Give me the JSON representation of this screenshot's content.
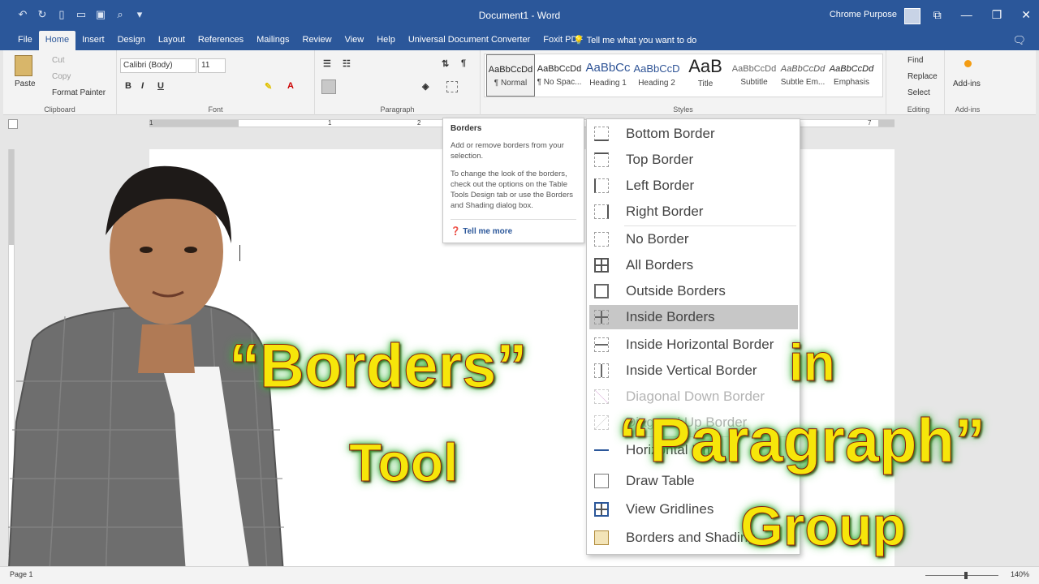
{
  "titlebar": {
    "doc_title": "Document1 - Word",
    "user": "Chrome Purpose"
  },
  "tabs": [
    "File",
    "Home",
    "Insert",
    "Design",
    "Layout",
    "References",
    "Mailings",
    "Review",
    "View",
    "Help",
    "Universal Document Converter",
    "Foxit PDF"
  ],
  "tell_me": "Tell me what you want to do",
  "clipboard": {
    "paste": "Paste",
    "cut": "Cut",
    "copy": "Copy",
    "format_painter": "Format Painter",
    "label": "Clipboard"
  },
  "font": {
    "name": "Calibri (Body)",
    "size": "11",
    "label": "Font"
  },
  "paragraph": {
    "label": "Paragraph"
  },
  "styles": {
    "label": "Styles",
    "items": [
      {
        "preview": "AaBbCcDd",
        "name": "¶ Normal"
      },
      {
        "preview": "AaBbCcDd",
        "name": "¶ No Spac..."
      },
      {
        "preview": "AaBbCc",
        "name": "Heading 1"
      },
      {
        "preview": "AaBbCcD",
        "name": "Heading 2"
      },
      {
        "preview": "AaB",
        "name": "Title"
      },
      {
        "preview": "AaBbCcDd",
        "name": "Subtitle"
      },
      {
        "preview": "AaBbCcDd",
        "name": "Subtle Em..."
      },
      {
        "preview": "AaBbCcDd",
        "name": "Emphasis"
      }
    ]
  },
  "editing": {
    "find": "Find",
    "replace": "Replace",
    "select": "Select",
    "label": "Editing"
  },
  "addins": {
    "button": "Add-ins",
    "label": "Add-ins"
  },
  "ruler_numbers": [
    "1",
    "1",
    "2",
    "7"
  ],
  "tooltip": {
    "title": "Borders",
    "p1": "Add or remove borders from your selection.",
    "p2": "To change the look of the borders, check out the options on the Table Tools Design tab or use the Borders and Shading dialog box.",
    "more": "Tell me more"
  },
  "border_menu": [
    {
      "label": "Bottom Border"
    },
    {
      "label": "Top Border"
    },
    {
      "label": "Left Border"
    },
    {
      "label": "Right Border"
    },
    {
      "label": "No Border"
    },
    {
      "label": "All Borders"
    },
    {
      "label": "Outside Borders"
    },
    {
      "label": "Inside Borders"
    },
    {
      "label": "Inside Horizontal Border"
    },
    {
      "label": "Inside Vertical Border"
    },
    {
      "label": "Diagonal Down Border"
    },
    {
      "label": "Diagonal Up Border"
    },
    {
      "label": "Horizontal Line"
    },
    {
      "label": "Draw Table"
    },
    {
      "label": "View Gridlines"
    },
    {
      "label": "Borders and Shading..."
    }
  ],
  "status": {
    "page": "Page 1",
    "zoom": "140%"
  },
  "overlay": {
    "borders": "“Borders”",
    "tool": "Tool",
    "in": "in",
    "paragraph": "“Paragraph”",
    "group": "Group"
  },
  "colors": {
    "brand": "#2b579a",
    "caption_fill": "#f6e60a",
    "caption_glow": "#3db83d"
  }
}
